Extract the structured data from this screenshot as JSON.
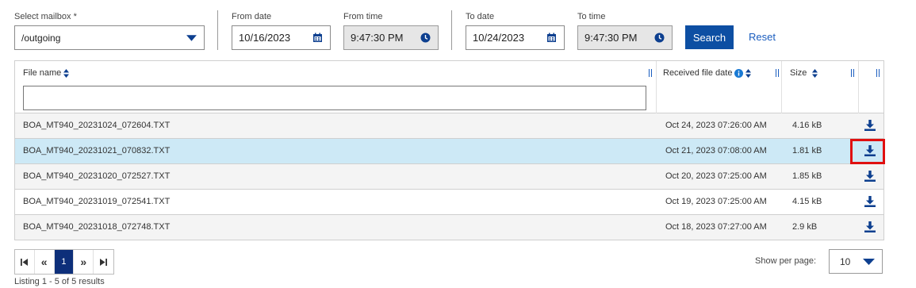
{
  "filters": {
    "mailbox": {
      "label": "Select mailbox *",
      "value": "/outgoing"
    },
    "from_date": {
      "label": "From date",
      "value": "10/16/2023"
    },
    "from_time": {
      "label": "From time",
      "value": "9:47:30 PM"
    },
    "to_date": {
      "label": "To date",
      "value": "10/24/2023"
    },
    "to_time": {
      "label": "To time",
      "value": "9:47:30 PM"
    },
    "search_label": "Search",
    "reset_label": "Reset"
  },
  "table": {
    "headers": {
      "file_name": "File name",
      "received": "Received file date",
      "size": "Size"
    },
    "filter_placeholder": "",
    "rows": [
      {
        "name": "BOA_MT940_20231024_072604.TXT",
        "received": "Oct 24, 2023 07:26:00 AM",
        "size": "4.16 kB"
      },
      {
        "name": "BOA_MT940_20231021_070832.TXT",
        "received": "Oct 21, 2023 07:08:00 AM",
        "size": "1.81 kB"
      },
      {
        "name": "BOA_MT940_20231020_072527.TXT",
        "received": "Oct 20, 2023 07:25:00 AM",
        "size": "1.85 kB"
      },
      {
        "name": "BOA_MT940_20231019_072541.TXT",
        "received": "Oct 19, 2023 07:25:00 AM",
        "size": "4.15 kB"
      },
      {
        "name": "BOA_MT940_20231018_072748.TXT",
        "received": "Oct 18, 2023 07:27:00 AM",
        "size": "2.9 kB"
      }
    ]
  },
  "pagination": {
    "first": "⏮",
    "prev": "«",
    "current": "1",
    "next": "»",
    "last": "⏭",
    "listing": "Listing 1 - 5 of 5 results",
    "per_page_label": "Show per page:",
    "per_page_value": "10"
  },
  "colors": {
    "accent": "#0d4fa3",
    "selected_row": "#cde9f6",
    "highlight": "#e01010"
  }
}
